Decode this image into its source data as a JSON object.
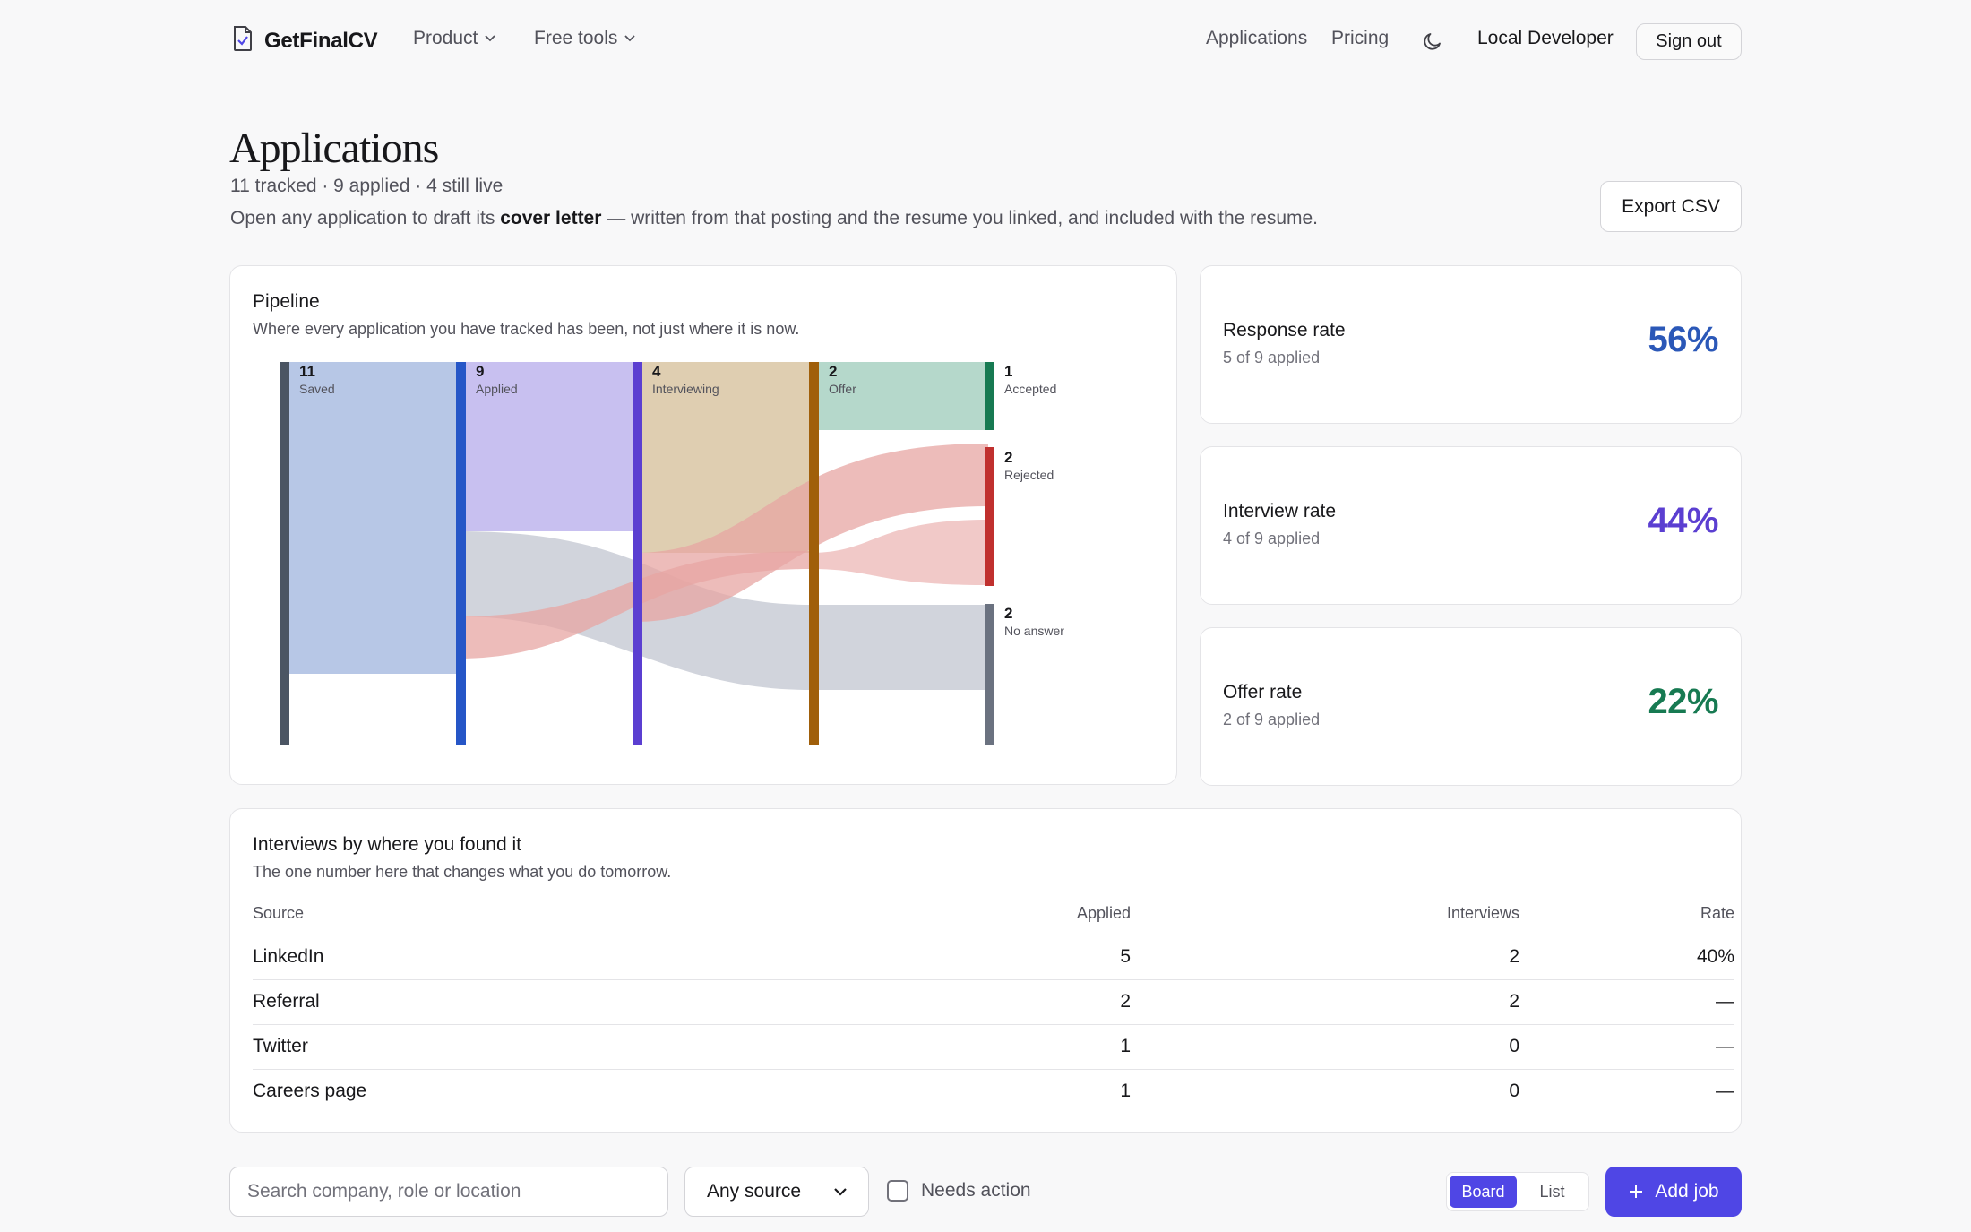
{
  "app": {
    "brand": "GetFinalCV",
    "colors": {
      "accent": "#4f46e5",
      "blue": "#2b58b8",
      "purple": "#5b3fd1",
      "green": "#177a52"
    }
  },
  "header": {
    "nav": [
      {
        "label": "Product",
        "icon": "chevron-down-icon"
      },
      {
        "label": "Free tools",
        "icon": "chevron-down-icon"
      }
    ],
    "links": {
      "applications": "Applications",
      "pricing": "Pricing"
    },
    "theme_icon": "moon-icon",
    "user": "Local Developer",
    "sign_out": "Sign out"
  },
  "page": {
    "title": "Applications",
    "summary": "11 tracked · 9 applied · 4 still live",
    "hint_before": "Open any application to draft its ",
    "hint_bold": "cover letter",
    "hint_after": " — written from that posting and the resume you linked, and included with the resume.",
    "export": "Export CSV"
  },
  "pipeline": {
    "title": "Pipeline",
    "subtitle": "Where every application you have tracked has been, not just where it is now.",
    "stages": [
      {
        "count": "11",
        "label": "Saved",
        "color": "#4b5563"
      },
      {
        "count": "9",
        "label": "Applied",
        "color": "#2656c7"
      },
      {
        "count": "4",
        "label": "Interviewing",
        "color": "#5b3fd1"
      },
      {
        "count": "2",
        "label": "Offer",
        "color": "#a05f0a"
      },
      {
        "count": "1",
        "label": "Accepted",
        "color": "#177a52"
      },
      {
        "count": "2",
        "label": "Rejected",
        "color": "#c0302e"
      },
      {
        "count": "2",
        "label": "No answer",
        "color": "#6b7280"
      }
    ]
  },
  "stats": [
    {
      "label": "Response rate",
      "sub": "5 of 9 applied",
      "value": "56%",
      "color": "#2b58b8"
    },
    {
      "label": "Interview rate",
      "sub": "4 of 9 applied",
      "value": "44%",
      "color": "#5b3fd1"
    },
    {
      "label": "Offer rate",
      "sub": "2 of 9 applied",
      "value": "22%",
      "color": "#177a52"
    }
  ],
  "sources": {
    "title": "Interviews by where you found it",
    "subtitle": "The one number here that changes what you do tomorrow.",
    "columns": [
      "Source",
      "Applied",
      "Interviews",
      "Rate"
    ],
    "rows": [
      {
        "source": "LinkedIn",
        "applied": "5",
        "interviews": "2",
        "rate": "40%"
      },
      {
        "source": "Referral",
        "applied": "2",
        "interviews": "2",
        "rate": "—"
      },
      {
        "source": "Twitter",
        "applied": "1",
        "interviews": "0",
        "rate": "—"
      },
      {
        "source": "Careers page",
        "applied": "1",
        "interviews": "0",
        "rate": "—"
      }
    ]
  },
  "toolbar": {
    "search_placeholder": "Search company, role or location",
    "source_select": "Any source",
    "needs_action": "Needs action",
    "view_board": "Board",
    "view_list": "List",
    "add_job": "Add job"
  }
}
